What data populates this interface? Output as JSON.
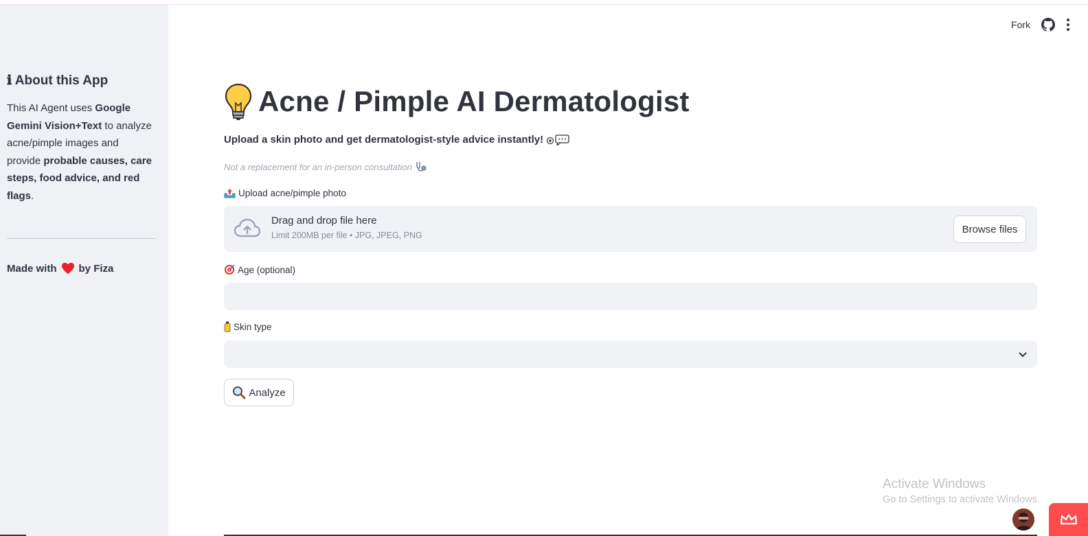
{
  "header": {
    "fork_label": "Fork",
    "github_icon": "github-icon",
    "menu_icon": "kebab-menu-icon"
  },
  "sidebar": {
    "title_icon": "ℹ",
    "title": "About this App",
    "desc_part1": "This AI Agent uses ",
    "desc_bold1": "Google Gemini Vision+Text",
    "desc_part2": " to analyze acne/pimple images and provide ",
    "desc_bold2": "probable causes, care steps, food advice, and red flags",
    "desc_part3": ".",
    "made_with": "Made with",
    "made_by": "by Fiza"
  },
  "main": {
    "title": "Acne / Pimple AI Dermatologist",
    "subtitle": "Upload a skin photo and get dermatologist-style advice instantly!",
    "caption": "Not a replacement for an in-person consultation",
    "upload_label": "Upload acne/pimple photo",
    "dropzone_main": "Drag and drop file here",
    "dropzone_sub": "Limit 200MB per file • JPG, JPEG, PNG",
    "browse_label": "Browse files",
    "age_label": "Age (optional)",
    "age_value": "",
    "skin_label": "Skin type",
    "skin_value": "",
    "analyze_label": "Analyze"
  },
  "watermark": {
    "line1": "Activate Windows",
    "line2": "Go to Settings to activate Windows."
  },
  "colors": {
    "accent": "#ff4b4b",
    "sidebar_bg": "#eff1f5",
    "input_bg": "#f0f2f6",
    "text": "#31333f"
  }
}
